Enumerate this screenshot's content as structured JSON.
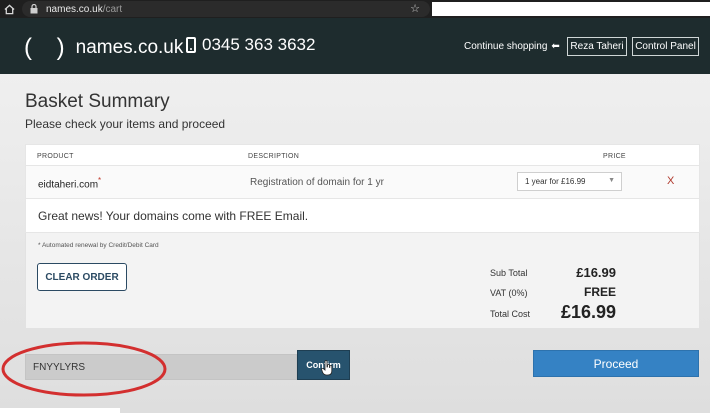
{
  "browser": {
    "url_domain": "names.co.uk",
    "url_path": "/cart"
  },
  "header": {
    "logo_text": "names.co.uk",
    "logo_parens": "( )",
    "phone": "0345 363 3632",
    "continue_label": "Continue shopping",
    "user_button": "Reza Taheri",
    "control_panel_button": "Control Panel"
  },
  "basket": {
    "title": "Basket Summary",
    "subtitle": "Please check your items and proceed",
    "columns": {
      "product": "PRODUCT",
      "description": "DESCRIPTION",
      "price": "PRICE"
    },
    "items": [
      {
        "product": "eidtaheri.com",
        "asterisk": "*",
        "description": "Registration of domain for 1 yr",
        "term": "1 year for £16.99",
        "remove": "X"
      }
    ],
    "news": "Great news! Your domains come with FREE Email.",
    "auto_renew_note": "* Automated renewal by Credit/Debit Card",
    "clear_order_label": "CLEAR ORDER",
    "totals": {
      "subtotal_label": "Sub Total",
      "subtotal_value": "£16.99",
      "vat_label": "VAT (0%)",
      "vat_value": "FREE",
      "total_label": "Total Cost",
      "total_value": "£16.99"
    },
    "promo_value": "FNYYLYRS",
    "confirm_label": "Confirm",
    "proceed_label": "Proceed"
  },
  "colors": {
    "header_bg": "#1e2c2e",
    "primary_button": "#3582c4",
    "confirm_button": "#27536e",
    "annotation": "#d32f2f"
  }
}
